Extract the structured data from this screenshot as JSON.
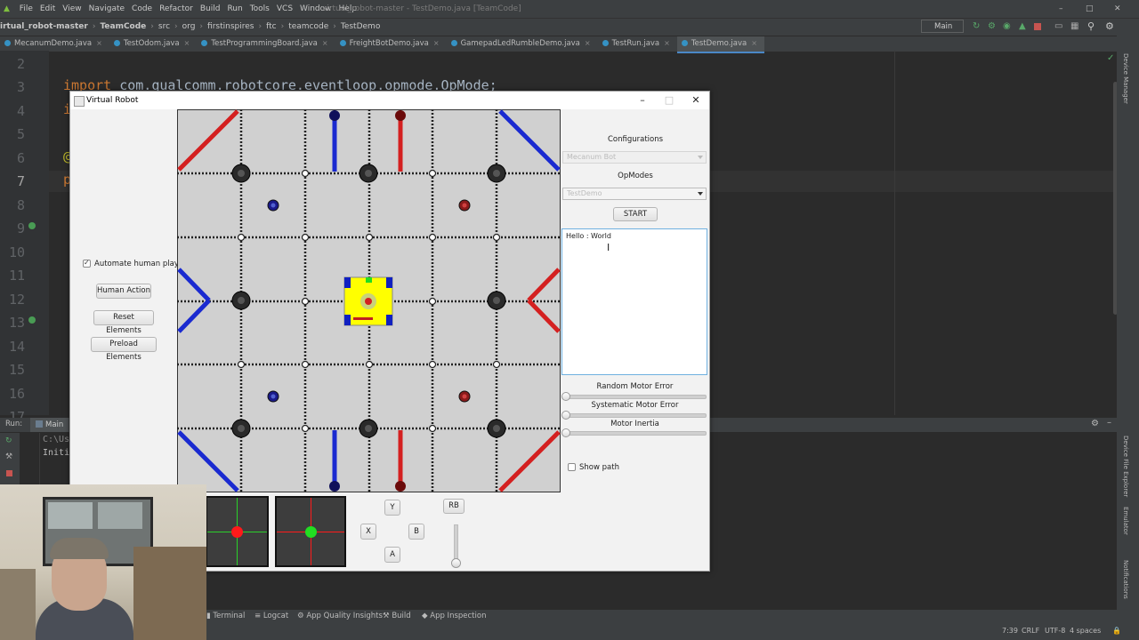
{
  "ide": {
    "menu": [
      "File",
      "Edit",
      "View",
      "Navigate",
      "Code",
      "Refactor",
      "Build",
      "Run",
      "Tools",
      "VCS",
      "Window",
      "Help"
    ],
    "window_title": "virtual_robot-master - TestDemo.java [TeamCode]",
    "breadcrumbs": [
      "irtual_robot-master",
      "TeamCode",
      "src",
      "org",
      "firstinspires",
      "ftc",
      "teamcode",
      "TestDemo"
    ],
    "run_config": "Main",
    "tabs": [
      "MecanumDemo.java",
      "TestOdom.java",
      "TestProgrammingBoard.java",
      "FreightBotDemo.java",
      "GamepadLedRumbleDemo.java",
      "TestRun.java",
      "TestDemo.java"
    ],
    "line_numbers": [
      "2",
      "3",
      "4",
      "5",
      "6",
      "7",
      "8",
      "9",
      "10",
      "11",
      "12",
      "13",
      "14",
      "15",
      "16",
      "17"
    ],
    "code_visible": {
      "import_kw": "import",
      "import_path": "com.qualcomm.robotcore.eventloop.opmode.OpMode;",
      "line4_start": "i",
      "line6_start": "@",
      "line7_start": "p"
    },
    "run_panel": {
      "label": "Run:",
      "config": "Main",
      "console_lines": [
        "C:\\Use",
        "Initi"
      ]
    },
    "bottom_tools": [
      "Terminal",
      "Logcat",
      "App Quality Insights",
      "Build",
      "App Inspection"
    ],
    "status": {
      "position": "7:39",
      "line_sep": "CRLF",
      "encoding": "UTF-8",
      "indent": "4 spaces"
    },
    "right_tools": [
      "Device Manager",
      "Device File Explorer",
      "Emulator",
      "Notifications"
    ]
  },
  "vr": {
    "title": "Virtual Robot",
    "automate_label": "Automate human player",
    "automate_checked": true,
    "human_action_label": "Human Action",
    "reset_label": "Reset Elements",
    "preload_label": "Preload Elements",
    "configurations_label": "Configurations",
    "config_value": "Mecanum Bot",
    "opmodes_label": "OpModes",
    "opmode_value": "TestDemo",
    "start_label": "START",
    "console_text": "Hello  : World",
    "random_error_label": "Random Motor Error",
    "random_error_value": 0,
    "systematic_error_label": "Systematic Motor Error",
    "systematic_error_value": 0,
    "inertia_label": "Motor Inertia",
    "inertia_value": 0,
    "show_path_label": "Show path",
    "show_path_checked": false,
    "buttons": {
      "y": "Y",
      "x": "X",
      "b": "B",
      "a": "A",
      "rb": "RB"
    },
    "trigger_value": 0
  },
  "colors": {
    "red_tape": "#d42020",
    "blue_tape": "#1a2ad0",
    "robot_yellow": "#ffff00",
    "robot_blue": "#1020c0",
    "field_tile": "#d0d0d0",
    "joystick_left_dot": "#ff1a1a",
    "joystick_right_dot": "#22dd22"
  }
}
